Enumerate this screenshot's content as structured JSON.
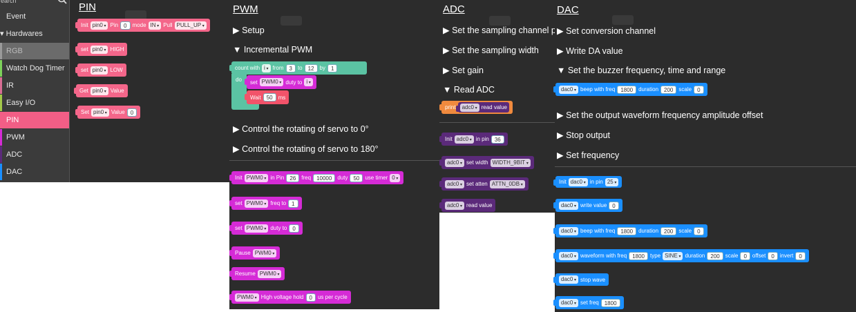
{
  "sidebar": {
    "search_placeholder": "earch",
    "items": [
      {
        "label": "Event",
        "color": "#3b3b3b"
      },
      {
        "label": "▾ Hardwares",
        "color": "#3b3b3b"
      },
      {
        "label": "RGB",
        "color": "#6b6b6b"
      },
      {
        "label": "Watch Dog Timer",
        "color": "#7cd15a"
      },
      {
        "label": "IR",
        "color": "#d96d94"
      },
      {
        "label": "Easy I/O",
        "color": "#a4c94a"
      },
      {
        "label": "PIN",
        "color": "#f25e86"
      },
      {
        "label": "PWM",
        "color": "#d52bd6"
      },
      {
        "label": "ADC",
        "color": "#5b2a7a"
      },
      {
        "label": "DAC",
        "color": "#1a8fff"
      }
    ]
  },
  "pin": {
    "title": "PIN",
    "blocks": {
      "init": {
        "a": "Init",
        "b": "pin0",
        "c": "Pin",
        "d": "0",
        "e": "mode",
        "f": "IN",
        "g": "Pull",
        "h": "PULL_UP"
      },
      "high": {
        "a": "set",
        "b": "pin0",
        "c": "HIGH"
      },
      "low": {
        "a": "set",
        "b": "pin0",
        "c": "LOW"
      },
      "get": {
        "a": "Get",
        "b": "pin0",
        "c": "Value"
      },
      "setv": {
        "a": "Set",
        "b": "pin0",
        "c": "Value",
        "d": "0"
      }
    }
  },
  "pwm": {
    "title": "PWM",
    "flyouts": [
      "▶ Setup",
      "▼ Incremental PWM",
      "▶ Control the rotating of servo to 0°",
      "▶ Control the rotating of servo to 180°"
    ],
    "loop": {
      "a": "count with",
      "b": "i",
      "c": "from",
      "d": "3",
      "e": "to",
      "f": "12",
      "g": "by",
      "h": "1",
      "do": "do"
    },
    "duty": {
      "a": "set",
      "b": "PWM0",
      "c": "duty to",
      "d": "i"
    },
    "wait": {
      "a": "Wait",
      "b": "50",
      "c": "ms"
    },
    "blocks": {
      "init": {
        "a": "Init",
        "b": "PWM0",
        "c": "in Pin",
        "d": "26",
        "e": "freq",
        "f": "10000",
        "g": "duty",
        "h": "50",
        "i": "use timer",
        "j": "0"
      },
      "freq": {
        "a": "set",
        "b": "PWM0",
        "c": "freq to",
        "d": "1"
      },
      "duty2": {
        "a": "set",
        "b": "PWM0",
        "c": "duty to",
        "d": "0"
      },
      "pause": {
        "a": "Pause",
        "b": "PWM0"
      },
      "resume": {
        "a": "Resume",
        "b": "PWM0"
      },
      "hold": {
        "a": "PWM0",
        "b": "High voltage hold",
        "c": "0",
        "d": "us per cycle"
      }
    }
  },
  "adc": {
    "title": "ADC",
    "flyouts": [
      "▶ Set the sampling channel pin",
      "▶ Set the sampling width",
      "▶ Set gain",
      "▼ Read ADC"
    ],
    "print": {
      "a": "print",
      "b": "adc0",
      "c": "read value"
    },
    "blocks": {
      "init": {
        "a": "Init",
        "b": "adc0",
        "c": "in pin",
        "d": "36"
      },
      "width": {
        "a": "adc0",
        "b": "set width",
        "c": "WIDTH_9BIT"
      },
      "atten": {
        "a": "adc0",
        "b": "set atten",
        "c": "ATTN_0DB"
      },
      "read": {
        "a": "adc0",
        "b": "read value"
      }
    }
  },
  "dac": {
    "title": "DAC",
    "flyouts": [
      "▶ Set conversion channel",
      "▶ Write DA value",
      "▼ Set the buzzer frequency, time and range",
      "▶ Set the output waveform frequency amplitude offset",
      "▶ Stop output",
      "▶ Set frequency"
    ],
    "beep_top": {
      "a": "dac0",
      "b": "beep with freq",
      "c": "1800",
      "d": "duration",
      "e": "200",
      "f": "scale",
      "g": "0"
    },
    "blocks": {
      "init": {
        "a": "Init",
        "b": "dac0",
        "c": "in pin",
        "d": "25"
      },
      "write": {
        "a": "dac0",
        "b": "write value",
        "c": "0"
      },
      "beep": {
        "a": "dac0",
        "b": "beep with freq",
        "c": "1800",
        "d": "duration",
        "e": "200",
        "f": "scale",
        "g": "0"
      },
      "wave": {
        "a": "dac0",
        "b": "waveform with freq",
        "c": "1800",
        "d": "type",
        "e": "SINE",
        "f": "duration",
        "g": "200",
        "h": "scale",
        "i": "0",
        "j": "offset",
        "k": "0",
        "l": "invert",
        "m": "0"
      },
      "stop": {
        "a": "dac0",
        "b": "stop wave"
      },
      "setf": {
        "a": "dac0",
        "b": "set freq",
        "c": "1800"
      }
    }
  }
}
